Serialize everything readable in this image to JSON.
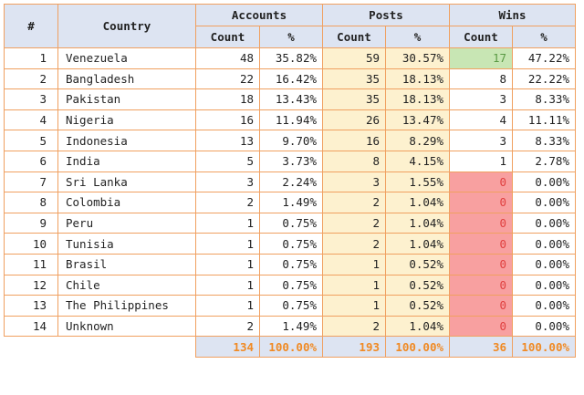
{
  "headers": {
    "rank": "#",
    "country": "Country",
    "accounts": "Accounts",
    "posts": "Posts",
    "wins": "Wins",
    "count": "Count",
    "pct": "%"
  },
  "rows": [
    {
      "rank": "1",
      "country": "Venezuela",
      "acc_count": "48",
      "acc_pct": "35.82%",
      "post_count": "59",
      "post_pct": "30.57%",
      "win_count": "17",
      "win_pct": "47.22%",
      "win_state": "hi"
    },
    {
      "rank": "2",
      "country": "Bangladesh",
      "acc_count": "22",
      "acc_pct": "16.42%",
      "post_count": "35",
      "post_pct": "18.13%",
      "win_count": "8",
      "win_pct": "22.22%",
      "win_state": "normal"
    },
    {
      "rank": "3",
      "country": "Pakistan",
      "acc_count": "18",
      "acc_pct": "13.43%",
      "post_count": "35",
      "post_pct": "18.13%",
      "win_count": "3",
      "win_pct": "8.33%",
      "win_state": "normal"
    },
    {
      "rank": "4",
      "country": "Nigeria",
      "acc_count": "16",
      "acc_pct": "11.94%",
      "post_count": "26",
      "post_pct": "13.47%",
      "win_count": "4",
      "win_pct": "11.11%",
      "win_state": "normal"
    },
    {
      "rank": "5",
      "country": "Indonesia",
      "acc_count": "13",
      "acc_pct": "9.70%",
      "post_count": "16",
      "post_pct": "8.29%",
      "win_count": "3",
      "win_pct": "8.33%",
      "win_state": "normal"
    },
    {
      "rank": "6",
      "country": "India",
      "acc_count": "5",
      "acc_pct": "3.73%",
      "post_count": "8",
      "post_pct": "4.15%",
      "win_count": "1",
      "win_pct": "2.78%",
      "win_state": "normal"
    },
    {
      "rank": "7",
      "country": "Sri Lanka",
      "acc_count": "3",
      "acc_pct": "2.24%",
      "post_count": "3",
      "post_pct": "1.55%",
      "win_count": "0",
      "win_pct": "0.00%",
      "win_state": "zero"
    },
    {
      "rank": "8",
      "country": "Colombia",
      "acc_count": "2",
      "acc_pct": "1.49%",
      "post_count": "2",
      "post_pct": "1.04%",
      "win_count": "0",
      "win_pct": "0.00%",
      "win_state": "zero"
    },
    {
      "rank": "9",
      "country": "Peru",
      "acc_count": "1",
      "acc_pct": "0.75%",
      "post_count": "2",
      "post_pct": "1.04%",
      "win_count": "0",
      "win_pct": "0.00%",
      "win_state": "zero"
    },
    {
      "rank": "10",
      "country": "Tunisia",
      "acc_count": "1",
      "acc_pct": "0.75%",
      "post_count": "2",
      "post_pct": "1.04%",
      "win_count": "0",
      "win_pct": "0.00%",
      "win_state": "zero"
    },
    {
      "rank": "11",
      "country": "Brasil",
      "acc_count": "1",
      "acc_pct": "0.75%",
      "post_count": "1",
      "post_pct": "0.52%",
      "win_count": "0",
      "win_pct": "0.00%",
      "win_state": "zero"
    },
    {
      "rank": "12",
      "country": "Chile",
      "acc_count": "1",
      "acc_pct": "0.75%",
      "post_count": "1",
      "post_pct": "0.52%",
      "win_count": "0",
      "win_pct": "0.00%",
      "win_state": "zero"
    },
    {
      "rank": "13",
      "country": "The Philippines",
      "acc_count": "1",
      "acc_pct": "0.75%",
      "post_count": "1",
      "post_pct": "0.52%",
      "win_count": "0",
      "win_pct": "0.00%",
      "win_state": "zero"
    },
    {
      "rank": "14",
      "country": "Unknown",
      "acc_count": "2",
      "acc_pct": "1.49%",
      "post_count": "2",
      "post_pct": "1.04%",
      "win_count": "0",
      "win_pct": "0.00%",
      "win_state": "zero"
    }
  ],
  "totals": {
    "acc_count": "134",
    "acc_pct": "100.00%",
    "post_count": "193",
    "post_pct": "100.00%",
    "win_count": "36",
    "win_pct": "100.00%"
  },
  "colors": {
    "border": "#f0a060",
    "header_bg": "#dde4f2",
    "posts_bg": "#fdf1cf",
    "win_high_bg": "#c8e6b4",
    "win_zero_bg": "#f8a0a0",
    "totals_text": "#f08a24"
  }
}
